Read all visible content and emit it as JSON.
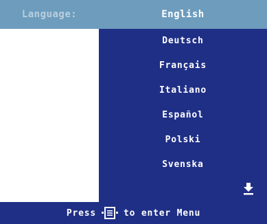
{
  "osd": {
    "header": {
      "label": "Language:",
      "value": "English"
    },
    "languages": [
      "Deutsch",
      "Français",
      "Italiano",
      "Español",
      "Polski",
      "Svenska"
    ],
    "scroll_icon": "down-arrow-icon",
    "footer": {
      "prefix": "Press",
      "icon": "menu-icon",
      "suffix": "to enter Menu"
    },
    "colors": {
      "header_bg": "#6d9cbd",
      "header_label": "#b9cfde",
      "panel_bg": "#1f2f86",
      "text": "#ffffff"
    }
  }
}
